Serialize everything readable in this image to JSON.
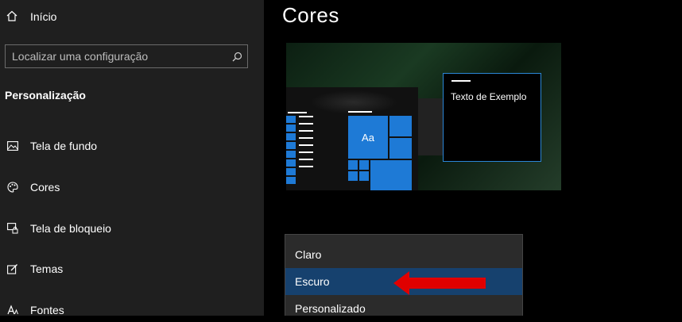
{
  "sidebar": {
    "home_label": "Início",
    "search_placeholder": "Localizar uma configuração",
    "section_title": "Personalização",
    "items": [
      {
        "label": "Tela de fundo",
        "icon": "image-icon"
      },
      {
        "label": "Cores",
        "icon": "palette-icon"
      },
      {
        "label": "Tela de bloqueio",
        "icon": "lock-screen-icon"
      },
      {
        "label": "Temas",
        "icon": "themes-icon"
      },
      {
        "label": "Fontes",
        "icon": "font-icon"
      }
    ]
  },
  "main": {
    "title": "Cores",
    "preview": {
      "tile_text": "Aa",
      "sample_window_text": "Texto de Exemplo"
    },
    "dropdown": {
      "options": [
        "Claro",
        "Escuro",
        "Personalizado"
      ],
      "selected": "Escuro"
    }
  },
  "colors": {
    "accent": "#1e7ad6",
    "sidebar_bg": "#1f1f1f",
    "dropdown_selected": "#16416e",
    "arrow": "#e00000"
  }
}
